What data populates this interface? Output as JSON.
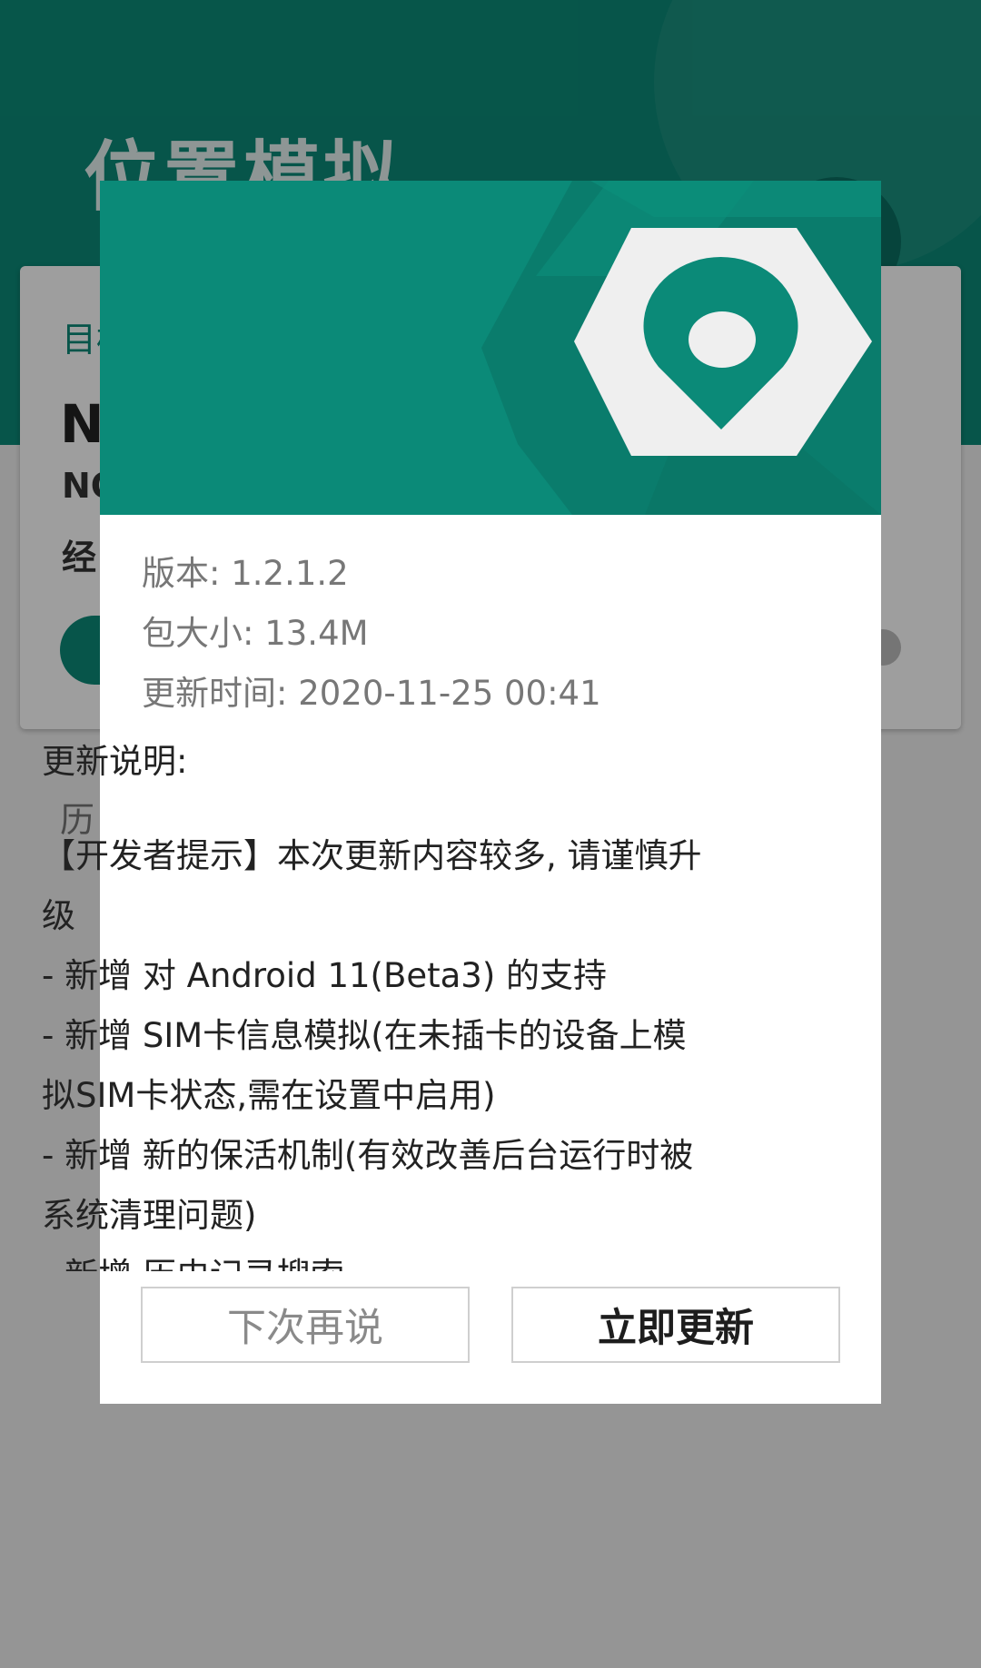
{
  "app": {
    "title": "位置模拟",
    "card_label": "目标",
    "card_big": "N",
    "card_sub": "NO",
    "card_meta": "经",
    "history_label": "历",
    "accent_color": "#0b8a78"
  },
  "dialog": {
    "banner_icon": "location-pin-hexagon-icon",
    "version": "版本: 1.2.1.2",
    "package_size": "包大小: 13.4M",
    "update_time": "更新时间: 2020-11-25 00:41",
    "notes_title": "更新说明:",
    "notes": [
      "【开发者提示】本次更新内容较多, 请谨慎升",
      "级",
      "- 新增  对 Android 11(Beta3) 的支持",
      "- 新增  SIM卡信息模拟(在未插卡的设备上模",
      "拟SIM卡状态,需在设置中启用)",
      "- 新增  新的保活机制(有效改善后台运行时被",
      "系统清理问题)",
      "- 新增  历史记录搜索"
    ],
    "buttons": {
      "later": "下次再说",
      "update": "立即更新"
    }
  }
}
